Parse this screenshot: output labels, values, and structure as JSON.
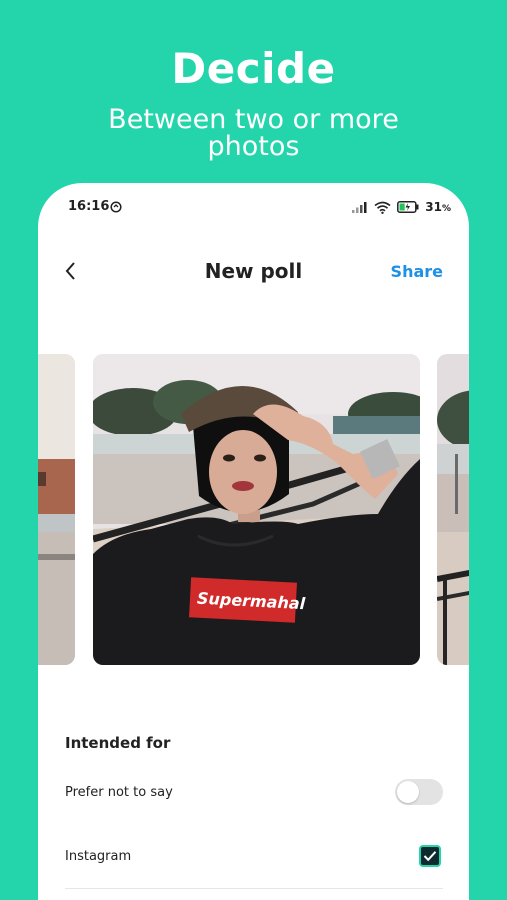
{
  "promo": {
    "title": "Decide",
    "subtitle_line1": "Between two or more",
    "subtitle_line2": "photos"
  },
  "status_bar": {
    "time": "16:16",
    "battery": "31",
    "battery_unit": "%"
  },
  "nav": {
    "title": "New poll",
    "share_label": "Share"
  },
  "carousel": {
    "center_logo_text": "Supermahal"
  },
  "intended_for": {
    "title": "Intended for",
    "options": [
      {
        "label": "Prefer not to say",
        "control": "toggle",
        "enabled": false
      },
      {
        "label": "Instagram",
        "control": "checkbox",
        "checked": true
      }
    ]
  },
  "colors": {
    "background": "#24d4aa",
    "accent": "#1e90e6",
    "checkbox_fill": "#0d2a2e"
  }
}
